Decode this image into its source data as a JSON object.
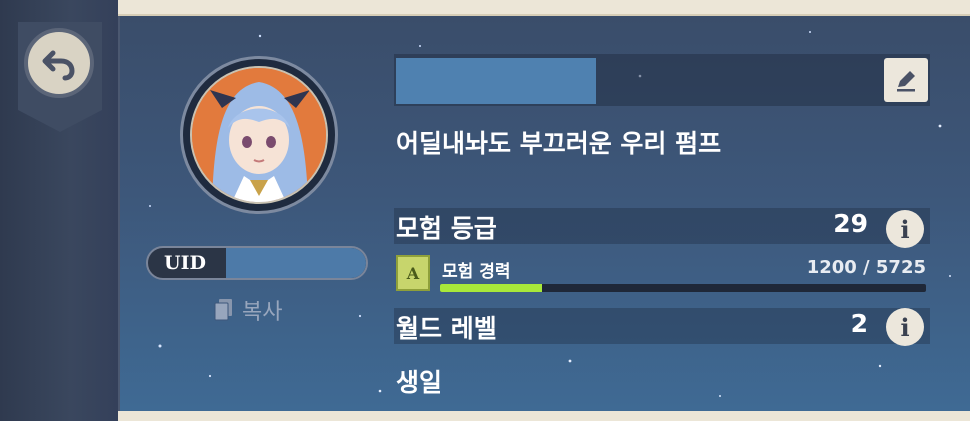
{
  "profile": {
    "player_name": "",
    "signature": "어딜내놔도 부끄러운 우리 펌프",
    "uid_label": "UID",
    "uid_value": "",
    "copy_label": "복사"
  },
  "stats": {
    "adventure_rank_label": "모험 등급",
    "adventure_rank_value": "29",
    "adventure_exp_label": "모험 경력",
    "adventure_exp_current": 1200,
    "adventure_exp_max": 5725,
    "adventure_exp_text": "1200 / 5725",
    "world_level_label": "월드 레벨",
    "world_level_value": "2",
    "birthday_label": "생일"
  },
  "icons": {
    "back": "back-arrow-icon",
    "edit": "edit-pencil-icon",
    "info": "info-icon",
    "copy": "copy-document-icon",
    "exp": "adventure-exp-icon"
  },
  "colors": {
    "panel_top": "#3a4d6a",
    "panel_bottom": "#3f6a94",
    "exp_fill": "#a8e83a",
    "button_bg": "#ece7dc"
  }
}
